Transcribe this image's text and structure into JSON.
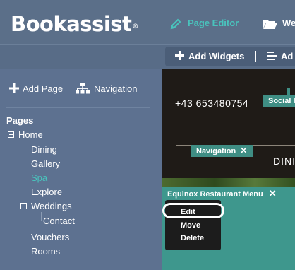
{
  "header": {
    "logo_text": "Bookassist",
    "logo_mark": "®",
    "nav": [
      {
        "label": "Page Editor",
        "icon": "pencil-icon",
        "active": true,
        "color": "#49c4bd"
      },
      {
        "label": "We",
        "icon": "folder-open-icon",
        "active": false
      }
    ]
  },
  "toolbar": {
    "add_widgets": "Add Widgets",
    "second_label": "Ad"
  },
  "left_panel": {
    "add_page": "Add Page",
    "navigation": "Navigation",
    "pages_title": "Pages",
    "tree": [
      {
        "label": "Home",
        "level": 0,
        "expandable": true
      },
      {
        "label": "Dining",
        "level": 1
      },
      {
        "label": "Gallery",
        "level": 1
      },
      {
        "label": "Spa",
        "level": 1,
        "active": true
      },
      {
        "label": "Explore",
        "level": 1
      },
      {
        "label": "Weddings",
        "level": 1,
        "expandable": true
      },
      {
        "label": "Contact",
        "level": 2
      },
      {
        "label": "Vouchers",
        "level": 1
      },
      {
        "label": "Rooms",
        "level": 1
      }
    ]
  },
  "preview": {
    "phone": "+43 653480754",
    "social_tag": "Social I",
    "navigation_tag": "Navigation",
    "dining_text": "DINI",
    "menu_widget_title": "Equinox Restaurant Menu",
    "context_menu": [
      "Edit",
      "Move",
      "Delete"
    ],
    "accent_color": "#3e978d"
  }
}
